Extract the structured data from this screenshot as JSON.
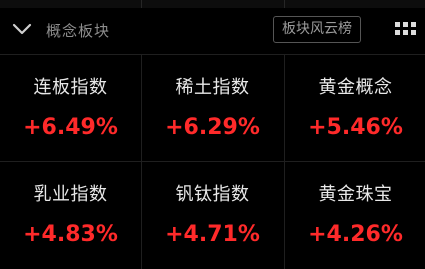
{
  "header": {
    "title": "概念板块",
    "rank_button": "板块风云榜"
  },
  "icons": {
    "collapse": "chevron-down-icon",
    "grid": "grid-menu-icon"
  },
  "colors": {
    "background": "#000000",
    "up": "#ff2a2a",
    "text": "#e8e8e8",
    "muted": "#8e8e8e"
  },
  "sectors": [
    {
      "name": "连板指数",
      "change": "+6.49%"
    },
    {
      "name": "稀土指数",
      "change": "+6.29%"
    },
    {
      "name": "黄金概念",
      "change": "+5.46%"
    },
    {
      "name": "乳业指数",
      "change": "+4.83%"
    },
    {
      "name": "钒钛指数",
      "change": "+4.71%"
    },
    {
      "name": "黄金珠宝",
      "change": "+4.26%"
    }
  ]
}
